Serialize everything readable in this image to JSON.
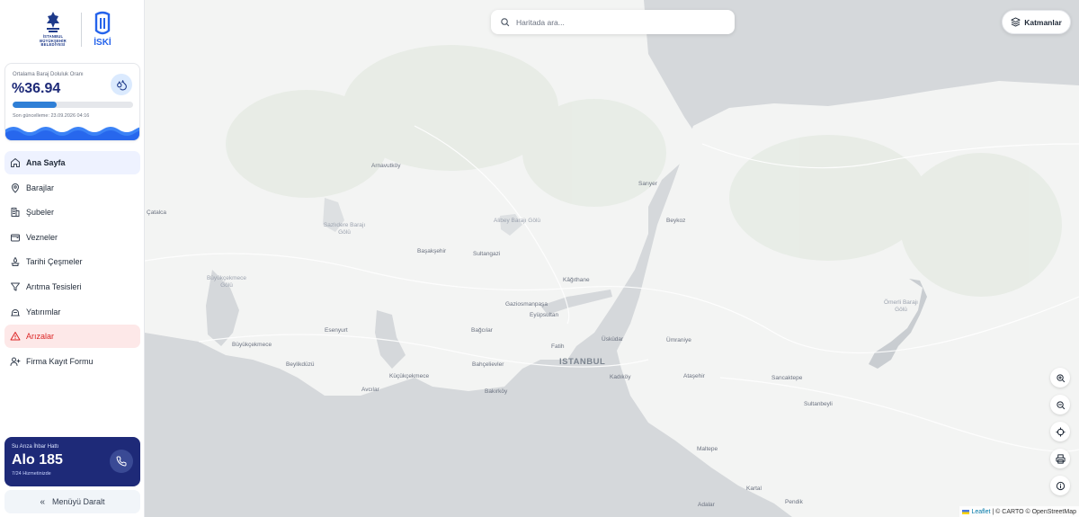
{
  "sidebar": {
    "logos": {
      "ibb_text": "İSTANBUL BÜYÜKŞEHİR BELEDİYESİ",
      "iski_text": "İSKİ"
    },
    "dam_card": {
      "label": "Ortalama Baraj Doluluk Oranı",
      "value": "%36.94",
      "fill_percent": 36.94,
      "updated": "Son güncelleme: 23.09.2026 04:16",
      "accent": "#1e2a78",
      "bar_color": "#2f7fd6"
    },
    "nav": [
      {
        "label": "Ana Sayfa",
        "icon": "home-icon",
        "state": "active"
      },
      {
        "label": "Barajlar",
        "icon": "map-pin-icon"
      },
      {
        "label": "Şubeler",
        "icon": "building-icon"
      },
      {
        "label": "Vezneler",
        "icon": "wallet-icon"
      },
      {
        "label": "Tarihi Çeşmeler",
        "icon": "fountain-icon"
      },
      {
        "label": "Arıtma Tesisleri",
        "icon": "filter-icon"
      },
      {
        "label": "Yatırımlar",
        "icon": "construction-icon"
      },
      {
        "label": "Arızalar",
        "icon": "warning-icon",
        "state": "alert"
      },
      {
        "label": "Firma Kayıt Formu",
        "icon": "user-plus-icon"
      }
    ],
    "hotline": {
      "label": "Su Arıza İhbar Hattı",
      "number": "Alo 185",
      "sub": "7/24 Hizmetinizde"
    },
    "collapse_label": "Menüyü Daralt"
  },
  "map": {
    "search_placeholder": "Haritada ara...",
    "layers_label": "Katmanlar",
    "places": {
      "arnavutkoy": "Arnavutköy",
      "sariyer": "Sarıyer",
      "catalca": "Çatalca",
      "sazlidere": "Sazlıdere Barajı Gölü",
      "alibey": "Alibey Barajı Gölü",
      "beykoz": "Beykoz",
      "basaksehir": "Başakşehir",
      "sultangazi": "Sultangazi",
      "buyukcekmece_lake": "Büyükçekmece Gölü",
      "kagithane": "Kâğıthane",
      "gaziosmanpasa": "Gaziosmanpaşa",
      "eyupsultan": "Eyüpsultan",
      "omerli": "Ömerli Barajı Gölü",
      "esenyurt": "Esenyurt",
      "bagcilar": "Bağcılar",
      "uskudar": "Üsküdar",
      "umraniye": "Ümraniye",
      "buyukcekmece": "Büyükçekmece",
      "fatih": "Fatih",
      "istanbul": "ISTANBUL",
      "beylikduzu": "Beylikdüzü",
      "bahcelievler": "Bahçelievler",
      "atasehir": "Ataşehir",
      "sancaktepe": "Sancaktepe",
      "kucukcekmece": "Küçükçekmece",
      "kadikoy": "Kadıköy",
      "avcilar": "Avcılar",
      "bakirkoy": "Bakırköy",
      "sultanbeyli": "Sultanbeyli",
      "maltepe": "Maltepe",
      "kartal": "Kartal",
      "pendik": "Pendik",
      "adalar": "Adalar"
    },
    "attribution": {
      "leaflet": "Leaflet",
      "rest": "| © CARTO © OpenStreetMap"
    },
    "land_color": "#f3f4f3",
    "water_color": "#d5d8db"
  }
}
